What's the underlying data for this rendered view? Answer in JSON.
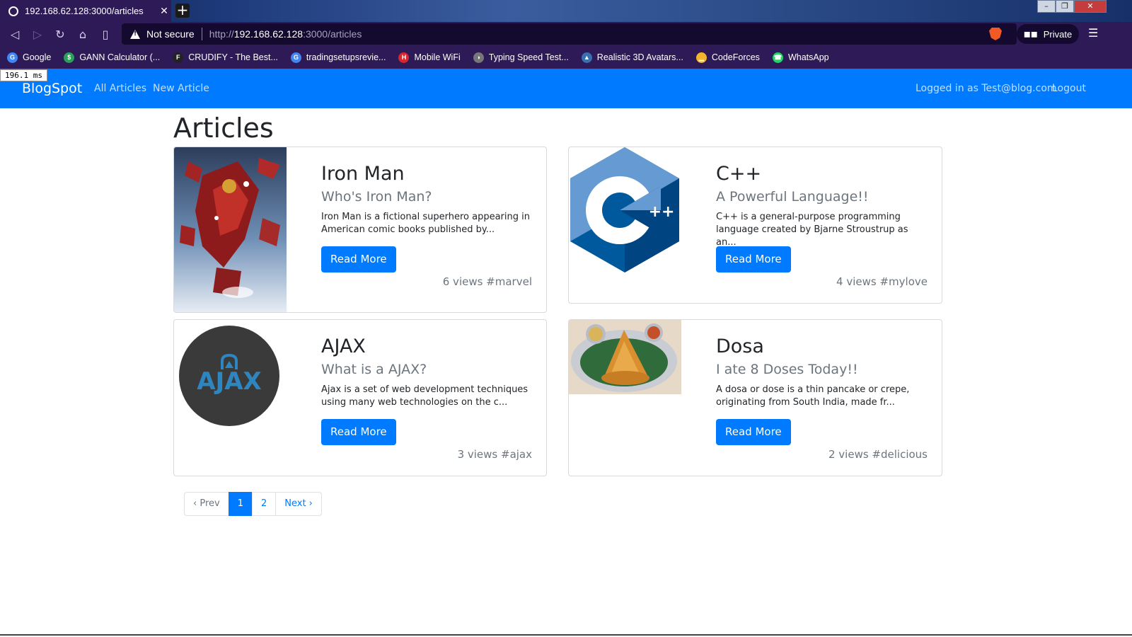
{
  "browser": {
    "tab_title": "192.168.62.128:3000/articles",
    "new_tab_glyph": "+",
    "not_secure": "Not secure",
    "url_scheme": "http://",
    "url_host": "192.168.62.128",
    "url_rest": ":3000/articles",
    "private_label": "Private",
    "bookmarks": [
      {
        "label": "Google",
        "color": "#4285f4",
        "icon": "G"
      },
      {
        "label": "GANN Calculator (...",
        "color": "#2e9e5b",
        "icon": "$"
      },
      {
        "label": "CRUDIFY - The Best...",
        "color": "#222222",
        "icon": "F"
      },
      {
        "label": "tradingsetupsrevie...",
        "color": "#4285f4",
        "icon": "G"
      },
      {
        "label": "Mobile WiFi",
        "color": "#d7262c",
        "icon": "H"
      },
      {
        "label": "Typing Speed Test...",
        "color": "#777777",
        "icon": "◑"
      },
      {
        "label": "Realistic 3D Avatars...",
        "color": "#3a6fb0",
        "icon": "▲"
      },
      {
        "label": "CodeForces",
        "color": "#f3b62b",
        "icon": "▁"
      },
      {
        "label": "WhatsApp",
        "color": "#25d366",
        "icon": "☎"
      }
    ],
    "perf": "196.1 ms"
  },
  "nav": {
    "brand": "BlogSpot",
    "all_articles": "All Articles",
    "new_article": "New Article",
    "logged_in": "Logged in as Test@blog.com",
    "logout": "Logout"
  },
  "page": {
    "title": "Articles"
  },
  "articles": [
    {
      "title": "Iron Man",
      "subtitle": "Who's Iron Man?",
      "text": "Iron Man is a fictional superhero appearing in American comic books published by...",
      "button": "Read More",
      "meta": "6 views #marvel",
      "image": "iron-man-image"
    },
    {
      "title": "C++",
      "subtitle": "A Powerful Language!!",
      "text": "C++ is a general-purpose programming language created by Bjarne Stroustrup as an...",
      "button": "Read More",
      "meta": "4 views #mylove",
      "image": "cpp-logo"
    },
    {
      "title": "AJAX",
      "subtitle": "What is a AJAX?",
      "text": "Ajax is a set of web development techniques using many web technologies on the c...",
      "button": "Read More",
      "meta": "3 views #ajax",
      "image": "ajax-logo"
    },
    {
      "title": "Dosa",
      "subtitle": "I ate 8 Doses Today!!",
      "text": "A dosa or dose is a thin pancake or crepe, originating from South India, made fr...",
      "button": "Read More",
      "meta": "2 views #delicious",
      "image": "dosa-image"
    }
  ],
  "logo_text": {
    "cpp_plus": "++",
    "ajax": "AJAX"
  },
  "pagination": {
    "prev": "‹ Prev",
    "pages": [
      "1",
      "2"
    ],
    "active_page": "1",
    "next": "Next ›"
  },
  "colors": {
    "primary": "#007bff",
    "browser_chrome": "#2e1a57",
    "muted": "#6c757d"
  }
}
